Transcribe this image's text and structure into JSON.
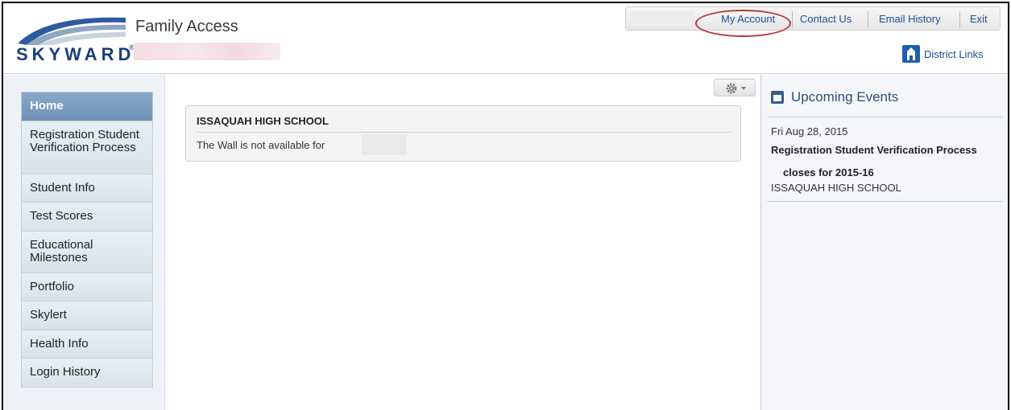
{
  "header": {
    "logo_text": "SKYWARD",
    "logo_mark": "®",
    "app_title": "Family Access",
    "top_links": [
      "My Account",
      "Contact Us",
      "Email History",
      "Exit"
    ],
    "district_links": "District Links"
  },
  "sidebar": {
    "items": [
      {
        "label": "Home",
        "active": true
      },
      {
        "label": "Registration Student Verification Process"
      },
      {
        "label": "Student Info"
      },
      {
        "label": "Test Scores"
      },
      {
        "label": "Educational Milestones"
      },
      {
        "label": "Portfolio"
      },
      {
        "label": "Skylert"
      },
      {
        "label": "Health Info"
      },
      {
        "label": "Login History"
      }
    ]
  },
  "main": {
    "card_title": "ISSAQUAH HIGH SCHOOL",
    "card_text": "The Wall is not available for"
  },
  "events": {
    "title": "Upcoming Events",
    "date": "Fri Aug 28, 2015",
    "name": "Registration Student Verification Process",
    "detail": "closes for 2015-16",
    "school": "ISSAQUAH HIGH SCHOOL"
  },
  "colors": {
    "link": "#1f4e9a",
    "active_nav": "#7495bc",
    "highlight_oval": "#b73a3a"
  },
  "icons": {
    "gear": "gear-icon",
    "district": "school-icon",
    "calendar": "calendar-icon"
  }
}
